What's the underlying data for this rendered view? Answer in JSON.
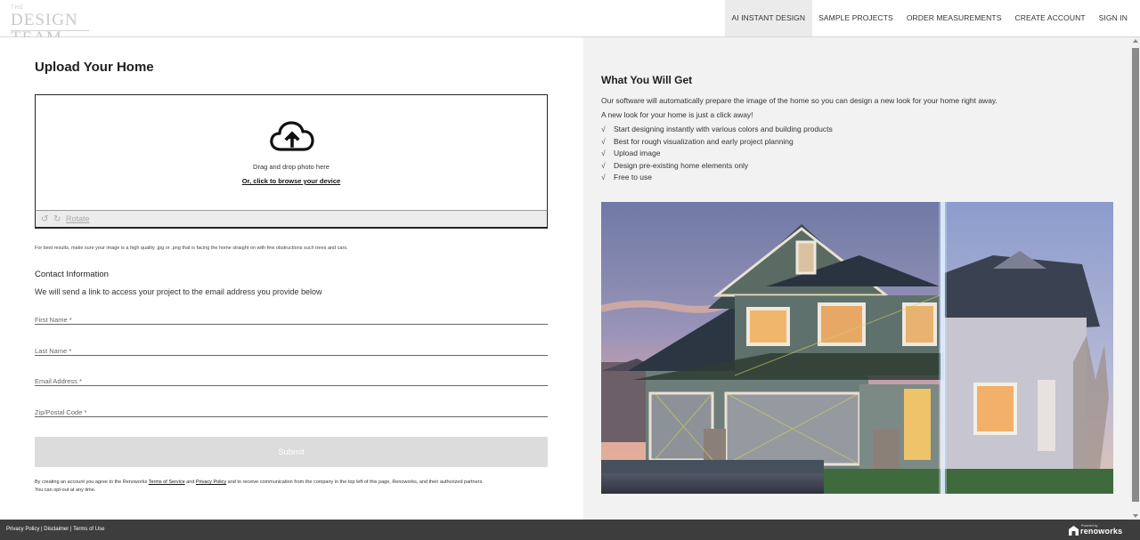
{
  "logo": {
    "small": "THE",
    "big": "DESIGN TEAM"
  },
  "nav": {
    "items": [
      {
        "label": "AI INSTANT DESIGN",
        "active": true
      },
      {
        "label": "SAMPLE PROJECTS"
      },
      {
        "label": "ORDER MEASUREMENTS"
      },
      {
        "label": "CREATE ACCOUNT"
      },
      {
        "label": "SIGN IN"
      }
    ]
  },
  "upload": {
    "title": "Upload Your Home",
    "drag_text": "Drag and drop photo here",
    "browse_text": "Or, click to browse your device",
    "rotate_label": "Rotate",
    "hint": "For best results, make sure your image is a high quality .jpg or .png that is facing the home straight on with few obstructions such trees and cars."
  },
  "contact": {
    "heading": "Contact Information",
    "subtitle": "We will send a link to access your project to the email address you provide below",
    "first_name_placeholder": "First Name *",
    "last_name_placeholder": "Last Name *",
    "email_placeholder": "Email Address *",
    "zip_placeholder": "Zip/Postal Code *",
    "submit_label": "Submit"
  },
  "legal": {
    "pre": "By creating an account you agree to the Renoworks ",
    "terms": "Terms of Service",
    "and": " and ",
    "privacy": "Privacy Policy",
    "post": " and to receive communication from the company in the top left of this page, Renoworks, and their authorized partners.",
    "line2": "You can opt-out at any time."
  },
  "right": {
    "title": "What You Will Get",
    "p1": "Our software will automatically prepare the image of the home so you can design a new look for your home right away.",
    "p2": "A new look for your home is just a click away!",
    "check_mark": "√",
    "checks": [
      "Start designing instantly with various colors and building products",
      "Best for rough visualization and early project planning",
      "Upload image",
      "Design pre-existing home elements only",
      "Free to use"
    ]
  },
  "footer": {
    "privacy": "Privacy Policy",
    "sep": " | ",
    "disclaimer": "Disclaimer",
    "terms": "Terms of Use",
    "powered_by": "Powered by",
    "brand": "renoworks"
  },
  "colors": {
    "active_nav_bg": "#ebebeb",
    "footer_bg": "#3d3d3d",
    "right_panel_bg": "#f2f2f2",
    "submit_disabled": "#dcdcdc"
  },
  "icons": [
    "cloud-upload-icon",
    "rotate-left-icon",
    "rotate-right-icon",
    "checkmark-icon",
    "renoworks-logo-icon"
  ]
}
